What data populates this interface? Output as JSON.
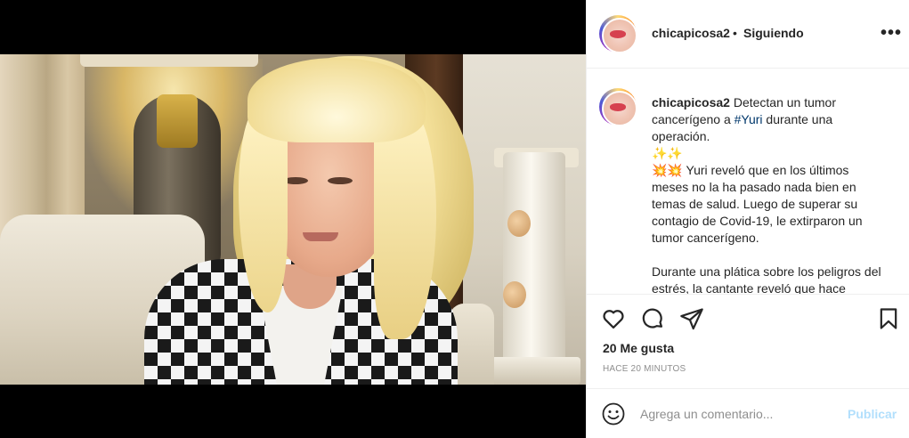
{
  "post": {
    "username": "chicapicosa2",
    "separator": "•",
    "follow_status": "Siguiendo",
    "more_glyph": "•••"
  },
  "caption": {
    "username": "chicapicosa2",
    "text_before_tag": " Detectan un tumor cancerígeno a ",
    "hashtag": "#Yuri",
    "text_after_tag": " durante una operación.",
    "emoji_line_1": "✨✨",
    "emoji_line_2_emoji": "💥💥",
    "paragraph_1": " Yuri reveló que en los últimos meses no la ha pasado nada bien en temas de salud. Luego de superar su contagio de Covid-19, le extirparon un tumor cancerígeno.",
    "paragraph_2": "Durante una plática sobre los peligros del estrés, la cantante reveló que hace"
  },
  "actions": {
    "like_icon": "heart-icon",
    "comment_icon": "comment-icon",
    "share_icon": "share-icon",
    "save_icon": "bookmark-icon"
  },
  "likes": "20 Me gusta",
  "timestamp": "HACE 20 MINUTOS",
  "comment_box": {
    "emoji_icon": "emoji-icon",
    "placeholder": "Agrega un comentario...",
    "publish_label": "Publicar"
  },
  "colors": {
    "link": "#00376b",
    "publish_disabled": "#b2dffc",
    "muted": "#8e8e8e",
    "text": "#262626"
  }
}
